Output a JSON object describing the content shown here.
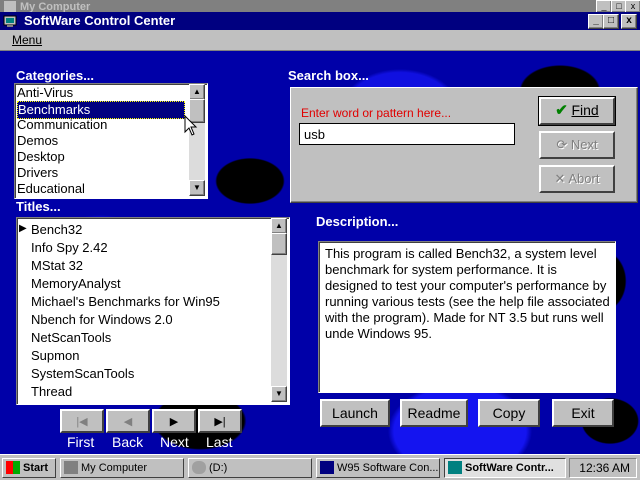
{
  "background_window": {
    "title": "My Computer"
  },
  "window": {
    "title": "SoftWare Control Center"
  },
  "menu": {
    "label": "Menu"
  },
  "categories": {
    "label": "Categories...",
    "items": [
      "Anti-Virus",
      "Benchmarks",
      "Communication",
      "Demos",
      "Desktop",
      "Drivers",
      "Educational"
    ],
    "selected": "Benchmarks"
  },
  "titles": {
    "label": "Titles...",
    "items": [
      "Bench32",
      "Info Spy 2.42",
      "MStat 32",
      "MemoryAnalyst",
      "Michael's Benchmarks for Win95",
      "Nbench for Windows 2.0",
      "NetScanTools",
      "Supmon",
      "SystemScanTools",
      "Thread"
    ],
    "selected": "Bench32"
  },
  "search": {
    "label": "Search box...",
    "hint": "Enter word or pattern here...",
    "value": "usb",
    "find_label": "Find",
    "next_label": "Next",
    "abort_label": "Abort"
  },
  "description": {
    "label": "Description...",
    "text": "This program is called Bench32, a system level benchmark for system performance. It is designed to test your computer's performance by running various tests (see the help file associated with the program). Made for NT 3.5  but runs well unde Windows 95."
  },
  "navigation": {
    "first": "First",
    "back": "Back",
    "next": "Next",
    "last": "Last"
  },
  "actions": {
    "launch": "Launch",
    "readme": "Readme",
    "copy": "Copy",
    "exit": "Exit"
  },
  "taskbar": {
    "start": "Start",
    "tasks": [
      "My Computer",
      "(D:)",
      "W95 Software Con...",
      "SoftWare Contr..."
    ],
    "clock": "12:36 AM"
  },
  "colors": {
    "title_bar": "#000080",
    "background": "#0000a8",
    "hint": "#e00000",
    "find_check": "#008000"
  }
}
